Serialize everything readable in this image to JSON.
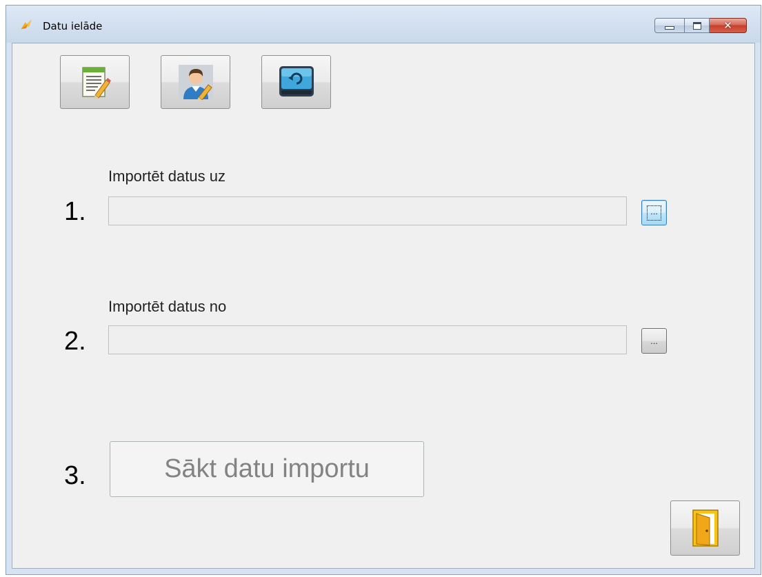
{
  "window": {
    "title": "Datu ielāde",
    "caption_buttons": {
      "minimize_icon": "minimize-icon",
      "maximize_icon": "maximize-icon",
      "close_icon": "close-icon",
      "close_glyph": "✕"
    }
  },
  "toolbar": {
    "buttons": [
      {
        "icon": "document-edit-icon"
      },
      {
        "icon": "user-edit-icon"
      },
      {
        "icon": "disk-restore-icon"
      }
    ]
  },
  "steps": [
    {
      "number": "1.",
      "label": "Importēt datus uz",
      "value": "",
      "browse_label": "...",
      "focused": true
    },
    {
      "number": "2.",
      "label": "Importēt datus no",
      "value": "",
      "browse_label": "...",
      "focused": false
    }
  ],
  "start": {
    "number": "3.",
    "label": "Sākt datu importu",
    "enabled": false
  },
  "exit": {
    "icon": "exit-door-icon"
  },
  "colors": {
    "title_bar": "#d3e0f0",
    "client_bg": "#f0f0f0",
    "close_button": "#c7402d",
    "focus_border": "#3c7fb1"
  }
}
